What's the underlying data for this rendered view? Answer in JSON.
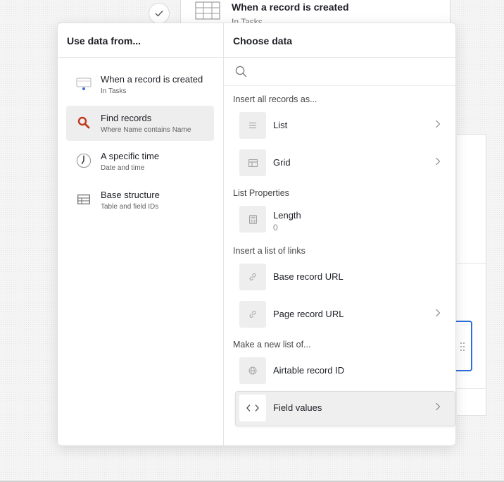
{
  "background": {
    "trigger_title": "When a record is created",
    "trigger_subtitle": "In Tasks"
  },
  "left_panel": {
    "header": "Use data from...",
    "sources": [
      {
        "name": "When a record is created",
        "sub": "In Tasks",
        "icon": "record-created-icon"
      },
      {
        "name": "Find records",
        "sub": "Where Name contains Name",
        "icon": "search-icon"
      },
      {
        "name": "A specific time",
        "sub": "Date and time",
        "icon": "clock-icon"
      },
      {
        "name": "Base structure",
        "sub": "Table and field IDs",
        "icon": "table-icon"
      }
    ]
  },
  "right_panel": {
    "header": "Choose data",
    "search_placeholder": "",
    "groups": {
      "insert_all": "Insert all records as...",
      "list_properties": "List Properties",
      "insert_links": "Insert a list of links",
      "new_list": "Make a new list of..."
    },
    "options": {
      "list": "List",
      "grid": "Grid",
      "length": "Length",
      "length_value": "0",
      "base_record_url": "Base record URL",
      "page_record_url": "Page record URL",
      "airtable_record_id": "Airtable record ID",
      "field_values": "Field values"
    }
  },
  "colors": {
    "accent_search": "#c0391e",
    "focus_border": "#2d6fd6"
  }
}
